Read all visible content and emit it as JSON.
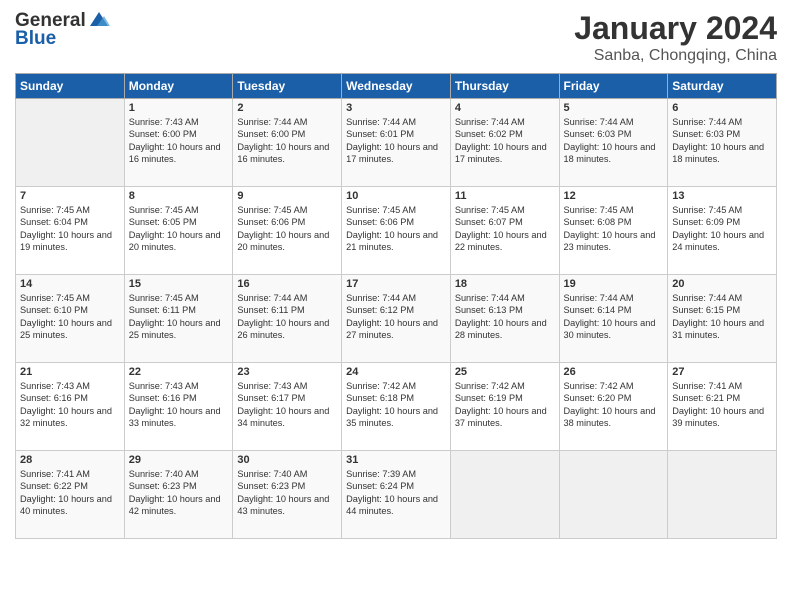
{
  "header": {
    "logo_general": "General",
    "logo_blue": "Blue",
    "month_title": "January 2024",
    "location": "Sanba, Chongqing, China"
  },
  "days_of_week": [
    "Sunday",
    "Monday",
    "Tuesday",
    "Wednesday",
    "Thursday",
    "Friday",
    "Saturday"
  ],
  "weeks": [
    [
      {
        "day": "",
        "empty": true
      },
      {
        "day": "1",
        "sunrise": "7:43 AM",
        "sunset": "6:00 PM",
        "daylight": "10 hours and 16 minutes."
      },
      {
        "day": "2",
        "sunrise": "7:44 AM",
        "sunset": "6:00 PM",
        "daylight": "10 hours and 16 minutes."
      },
      {
        "day": "3",
        "sunrise": "7:44 AM",
        "sunset": "6:01 PM",
        "daylight": "10 hours and 17 minutes."
      },
      {
        "day": "4",
        "sunrise": "7:44 AM",
        "sunset": "6:02 PM",
        "daylight": "10 hours and 17 minutes."
      },
      {
        "day": "5",
        "sunrise": "7:44 AM",
        "sunset": "6:03 PM",
        "daylight": "10 hours and 18 minutes."
      },
      {
        "day": "6",
        "sunrise": "7:44 AM",
        "sunset": "6:03 PM",
        "daylight": "10 hours and 18 minutes."
      }
    ],
    [
      {
        "day": "7",
        "sunrise": "7:45 AM",
        "sunset": "6:04 PM",
        "daylight": "10 hours and 19 minutes."
      },
      {
        "day": "8",
        "sunrise": "7:45 AM",
        "sunset": "6:05 PM",
        "daylight": "10 hours and 20 minutes."
      },
      {
        "day": "9",
        "sunrise": "7:45 AM",
        "sunset": "6:06 PM",
        "daylight": "10 hours and 20 minutes."
      },
      {
        "day": "10",
        "sunrise": "7:45 AM",
        "sunset": "6:06 PM",
        "daylight": "10 hours and 21 minutes."
      },
      {
        "day": "11",
        "sunrise": "7:45 AM",
        "sunset": "6:07 PM",
        "daylight": "10 hours and 22 minutes."
      },
      {
        "day": "12",
        "sunrise": "7:45 AM",
        "sunset": "6:08 PM",
        "daylight": "10 hours and 23 minutes."
      },
      {
        "day": "13",
        "sunrise": "7:45 AM",
        "sunset": "6:09 PM",
        "daylight": "10 hours and 24 minutes."
      }
    ],
    [
      {
        "day": "14",
        "sunrise": "7:45 AM",
        "sunset": "6:10 PM",
        "daylight": "10 hours and 25 minutes."
      },
      {
        "day": "15",
        "sunrise": "7:45 AM",
        "sunset": "6:11 PM",
        "daylight": "10 hours and 25 minutes."
      },
      {
        "day": "16",
        "sunrise": "7:44 AM",
        "sunset": "6:11 PM",
        "daylight": "10 hours and 26 minutes."
      },
      {
        "day": "17",
        "sunrise": "7:44 AM",
        "sunset": "6:12 PM",
        "daylight": "10 hours and 27 minutes."
      },
      {
        "day": "18",
        "sunrise": "7:44 AM",
        "sunset": "6:13 PM",
        "daylight": "10 hours and 28 minutes."
      },
      {
        "day": "19",
        "sunrise": "7:44 AM",
        "sunset": "6:14 PM",
        "daylight": "10 hours and 30 minutes."
      },
      {
        "day": "20",
        "sunrise": "7:44 AM",
        "sunset": "6:15 PM",
        "daylight": "10 hours and 31 minutes."
      }
    ],
    [
      {
        "day": "21",
        "sunrise": "7:43 AM",
        "sunset": "6:16 PM",
        "daylight": "10 hours and 32 minutes."
      },
      {
        "day": "22",
        "sunrise": "7:43 AM",
        "sunset": "6:16 PM",
        "daylight": "10 hours and 33 minutes."
      },
      {
        "day": "23",
        "sunrise": "7:43 AM",
        "sunset": "6:17 PM",
        "daylight": "10 hours and 34 minutes."
      },
      {
        "day": "24",
        "sunrise": "7:42 AM",
        "sunset": "6:18 PM",
        "daylight": "10 hours and 35 minutes."
      },
      {
        "day": "25",
        "sunrise": "7:42 AM",
        "sunset": "6:19 PM",
        "daylight": "10 hours and 37 minutes."
      },
      {
        "day": "26",
        "sunrise": "7:42 AM",
        "sunset": "6:20 PM",
        "daylight": "10 hours and 38 minutes."
      },
      {
        "day": "27",
        "sunrise": "7:41 AM",
        "sunset": "6:21 PM",
        "daylight": "10 hours and 39 minutes."
      }
    ],
    [
      {
        "day": "28",
        "sunrise": "7:41 AM",
        "sunset": "6:22 PM",
        "daylight": "10 hours and 40 minutes."
      },
      {
        "day": "29",
        "sunrise": "7:40 AM",
        "sunset": "6:23 PM",
        "daylight": "10 hours and 42 minutes."
      },
      {
        "day": "30",
        "sunrise": "7:40 AM",
        "sunset": "6:23 PM",
        "daylight": "10 hours and 43 minutes."
      },
      {
        "day": "31",
        "sunrise": "7:39 AM",
        "sunset": "6:24 PM",
        "daylight": "10 hours and 44 minutes."
      },
      {
        "day": "",
        "empty": true
      },
      {
        "day": "",
        "empty": true
      },
      {
        "day": "",
        "empty": true
      }
    ]
  ]
}
